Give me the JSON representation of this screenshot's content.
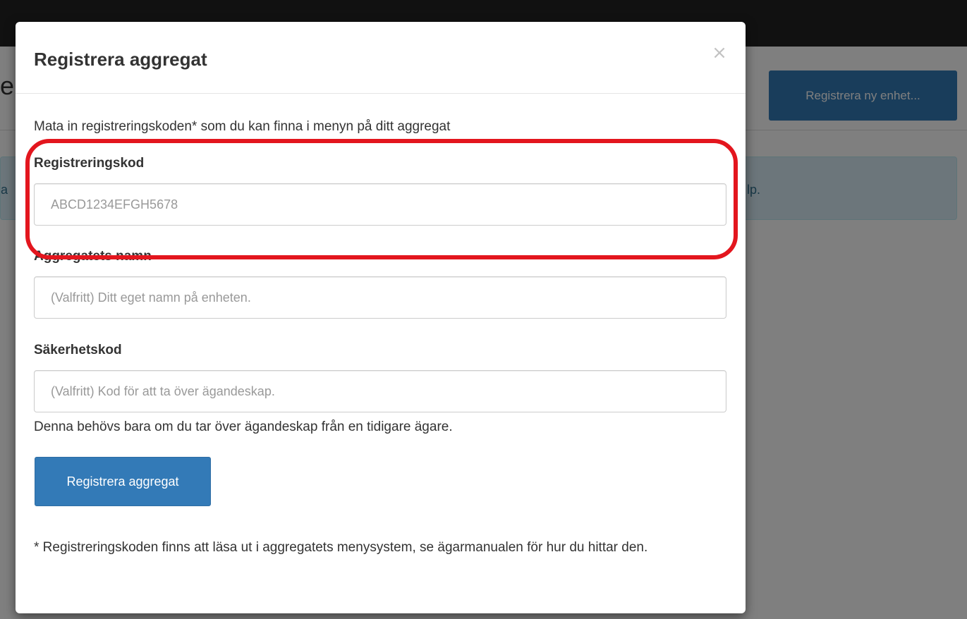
{
  "background": {
    "page_title_fragment": "e",
    "register_new_button": "Registrera ny enhet...",
    "alert_left_fragment": "a",
    "alert_right_fragment": "lp."
  },
  "modal": {
    "title": "Registrera aggregat",
    "close_symbol": "×",
    "intro": "Mata in registreringskoden* som du kan finna i menyn på ditt aggregat",
    "registration_code": {
      "label": "Registreringskod",
      "placeholder": "ABCD1234EFGH5678"
    },
    "unit_name": {
      "label": "Aggregatets namn",
      "placeholder": "(Valfritt) Ditt eget namn på enheten."
    },
    "security_code": {
      "label": "Säkerhetskod",
      "placeholder": "(Valfritt) Kod för att ta över ägandeskap.",
      "help": "Denna behövs bara om du tar över ägandeskap från en tidigare ägare."
    },
    "submit_label": "Registrera aggregat",
    "footnote": "* Registreringskoden finns att läsa ut i aggregatets menysystem, se ägarmanualen för hur du hittar den."
  },
  "colors": {
    "primary_button": "#337ab7",
    "annotation_outline": "#e3161e",
    "navbar": "#222222",
    "info_alert": "#d9edf7"
  }
}
